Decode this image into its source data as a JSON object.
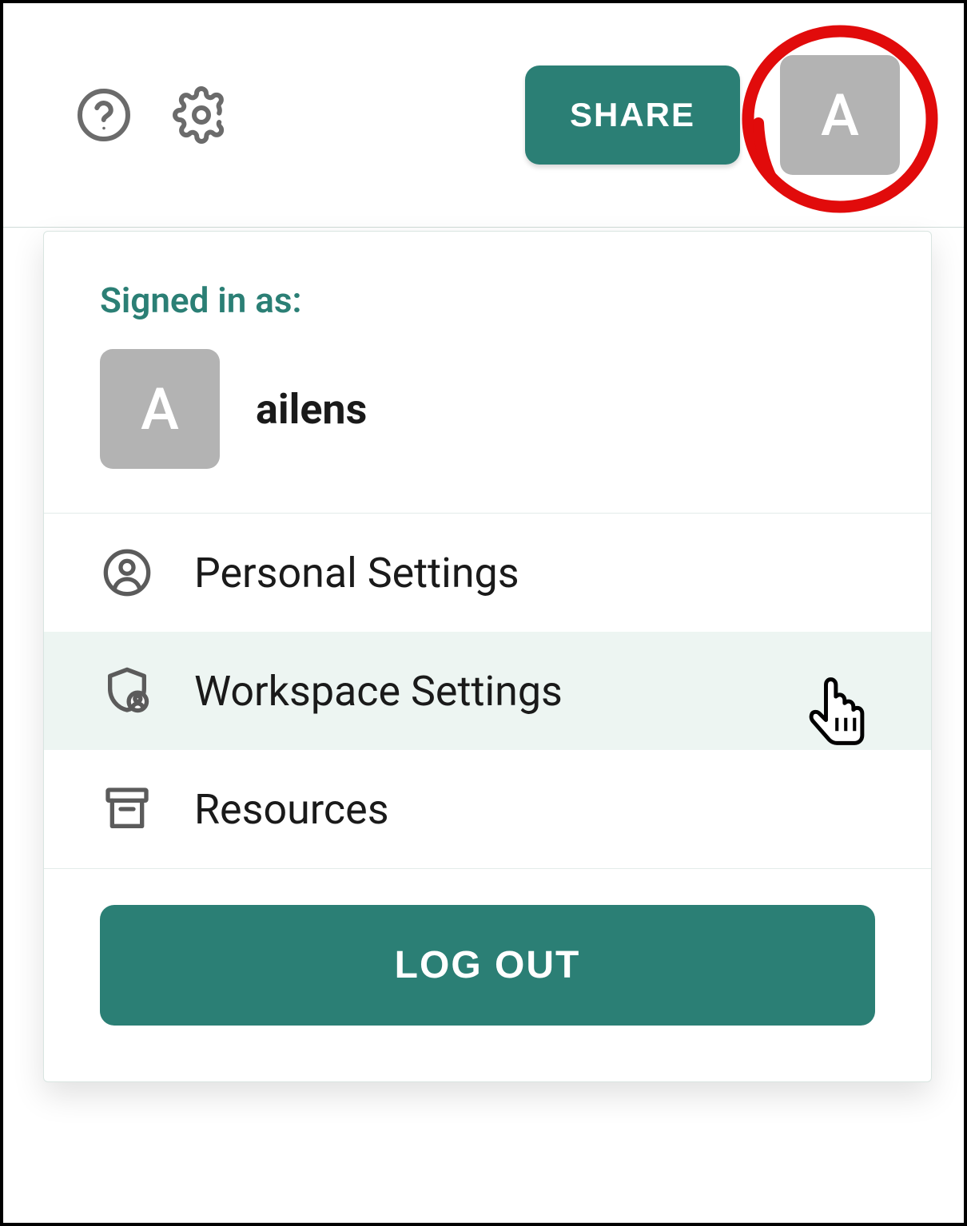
{
  "toolbar": {
    "share_label": "SHARE",
    "avatar_initial": "A"
  },
  "dropdown": {
    "signed_in_label": "Signed in as:",
    "avatar_initial": "A",
    "username": "ailens",
    "menu_items": [
      {
        "label": "Personal Settings",
        "icon": "user-circle-icon",
        "hovered": false
      },
      {
        "label": "Workspace Settings",
        "icon": "shield-user-icon",
        "hovered": true
      },
      {
        "label": "Resources",
        "icon": "archive-icon",
        "hovered": false
      }
    ],
    "logout_label": "LOG OUT"
  },
  "colors": {
    "accent": "#2b7f75",
    "avatar_bg": "#b3b3b3",
    "annotation": "#e10b0b"
  }
}
